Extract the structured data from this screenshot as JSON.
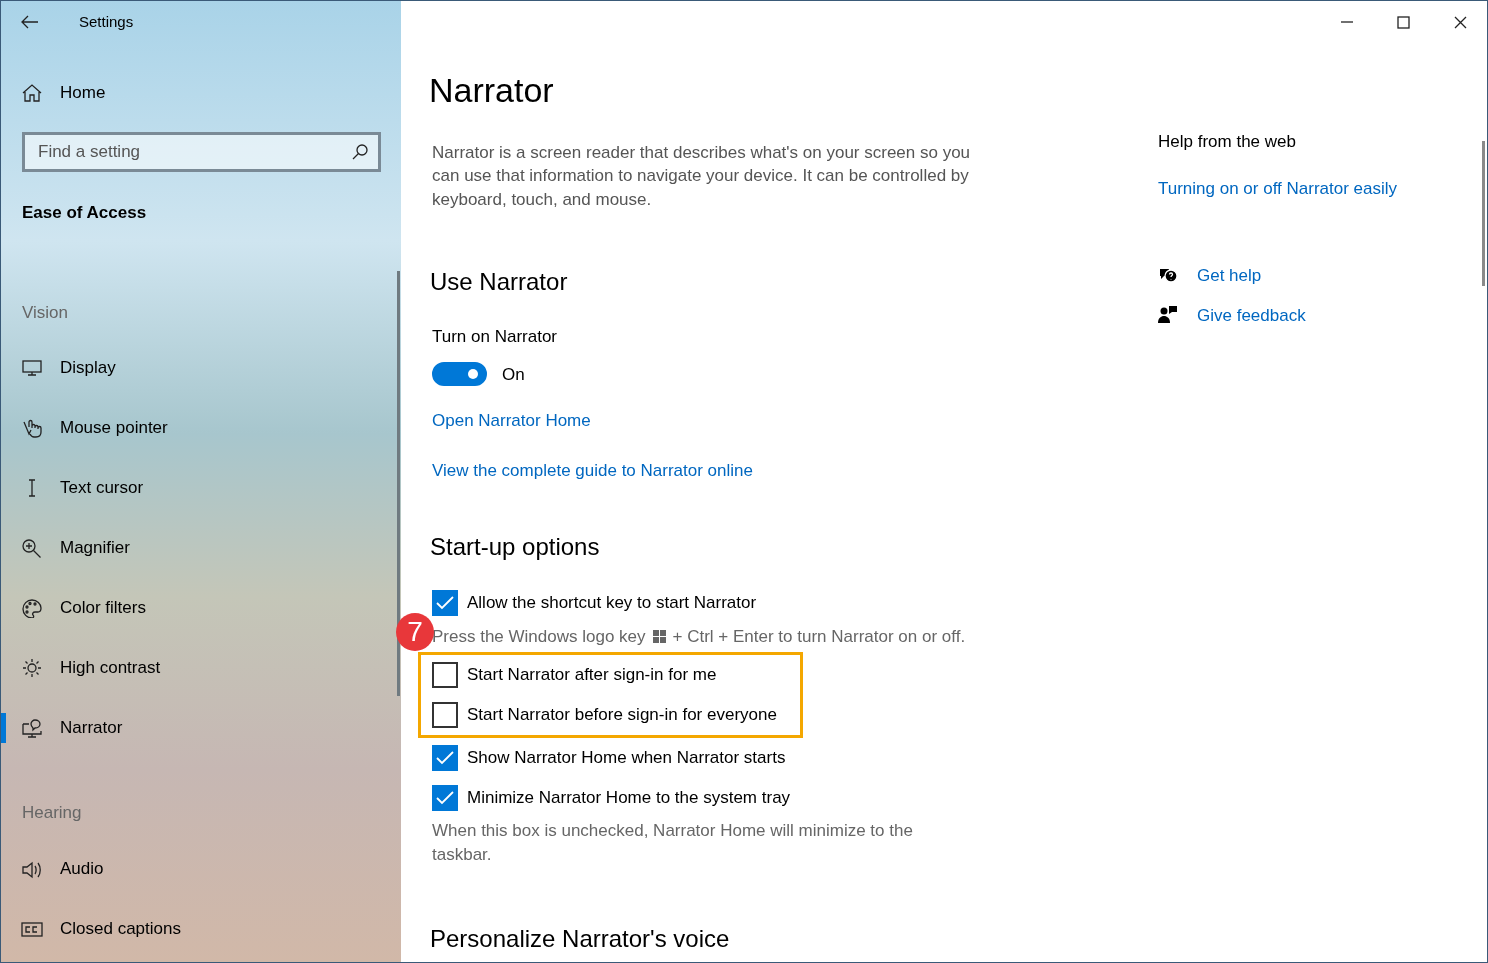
{
  "window": {
    "title": "Settings"
  },
  "sidebar": {
    "home": "Home",
    "search": {
      "placeholder": "Find a setting"
    },
    "category": "Ease of Access",
    "groups": [
      {
        "heading": "Vision",
        "items": [
          {
            "label": "Display",
            "selected": false
          },
          {
            "label": "Mouse pointer",
            "selected": false
          },
          {
            "label": "Text cursor",
            "selected": false
          },
          {
            "label": "Magnifier",
            "selected": false
          },
          {
            "label": "Color filters",
            "selected": false
          },
          {
            "label": "High contrast",
            "selected": false
          },
          {
            "label": "Narrator",
            "selected": true
          }
        ]
      },
      {
        "heading": "Hearing",
        "items": [
          {
            "label": "Audio",
            "selected": false
          },
          {
            "label": "Closed captions",
            "selected": false
          }
        ]
      }
    ]
  },
  "page": {
    "title": "Narrator",
    "description": "Narrator is a screen reader that describes what's on your screen so you can use that information to navigate your device. It can be controlled by keyboard, touch, and mouse.",
    "use_section": {
      "heading": "Use Narrator",
      "toggle_label": "Turn on Narrator",
      "toggle_on": true,
      "toggle_state": "On",
      "links": [
        "Open Narrator Home",
        "View the complete guide to Narrator online"
      ]
    },
    "startup_section": {
      "heading": "Start-up options",
      "options": [
        {
          "label": "Allow the shortcut key to start Narrator",
          "checked": true,
          "highlighted": false,
          "hint_before": "Press the Windows logo key",
          "hint_after": "+ Ctrl + Enter to turn Narrator on or off."
        },
        {
          "label": "Start Narrator after sign-in for me",
          "checked": false,
          "highlighted": true
        },
        {
          "label": "Start Narrator before sign-in for everyone",
          "checked": false,
          "highlighted": true
        },
        {
          "label": "Show Narrator Home when Narrator starts",
          "checked": true,
          "highlighted": false
        },
        {
          "label": "Minimize Narrator Home to the system tray",
          "checked": true,
          "highlighted": false,
          "hint": "When this box is unchecked, Narrator Home will minimize to the taskbar."
        }
      ]
    },
    "next_heading": "Personalize Narrator's voice"
  },
  "help": {
    "heading": "Help from the web",
    "link": "Turning on or off Narrator easily",
    "actions": [
      "Get help",
      "Give feedback"
    ]
  },
  "callout": {
    "number": "7"
  }
}
